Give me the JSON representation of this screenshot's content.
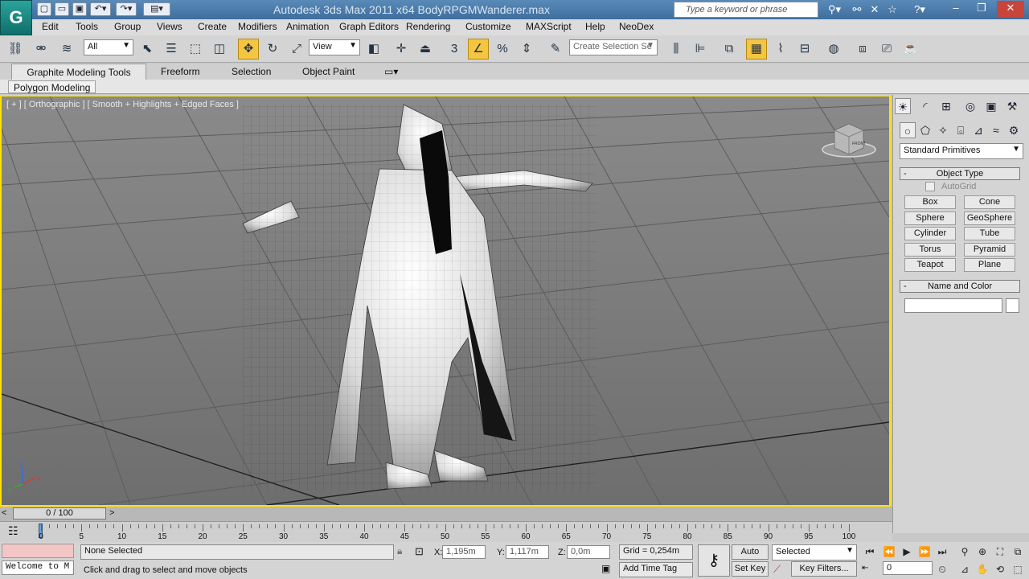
{
  "title_bar": {
    "app_logo": "G",
    "window_title": "Autodesk 3ds Max  2011 x64      BodyRPGMWanderer.max",
    "search_placeholder": "Type a keyword or phrase"
  },
  "menu": [
    "Edit",
    "Tools",
    "Group",
    "Views",
    "Create",
    "Modifiers",
    "Animation",
    "Graph Editors",
    "Rendering",
    "Customize",
    "MAXScript",
    "Help",
    "NeoDex"
  ],
  "toolbar": {
    "filter_value": "All",
    "ref_coord_value": "View",
    "selection_set_placeholder": "Create Selection Se",
    "snap_value": "3"
  },
  "ribbon": {
    "tabs": [
      "Graphite Modeling Tools",
      "Freeform",
      "Selection",
      "Object Paint"
    ],
    "panel_label": "Polygon Modeling"
  },
  "viewport": {
    "label": "[ + ] [ Orthographic ] [ Smooth + Highlights + Edged Faces ]",
    "viewcube_label": "FRONT",
    "axes": {
      "x": "x",
      "y": "y",
      "z": "z"
    }
  },
  "command_panel": {
    "category_value": "Standard Primitives",
    "object_type_title": "Object Type",
    "autogrid_label": "AutoGrid",
    "primitives": [
      "Box",
      "Cone",
      "Sphere",
      "GeoSphere",
      "Cylinder",
      "Tube",
      "Torus",
      "Pyramid",
      "Teapot",
      "Plane"
    ],
    "name_color_title": "Name and Color",
    "name_value": ""
  },
  "timeline": {
    "frame_display": "0 / 100",
    "ticks": [
      "0",
      "5",
      "10",
      "15",
      "20",
      "25",
      "30",
      "35",
      "40",
      "45",
      "50",
      "55",
      "60",
      "65",
      "70",
      "75",
      "80",
      "85",
      "90",
      "95",
      "100"
    ]
  },
  "status": {
    "maxscript_listener": "Welcome to M",
    "selection_status": "None Selected",
    "prompt": "Click and drag to select and move objects",
    "x_label": "X:",
    "x_value": "1,195m",
    "y_label": "Y:",
    "y_value": "1,117m",
    "z_label": "Z:",
    "z_value": "0,0m",
    "grid": "Grid = 0,254m",
    "add_time_tag": "Add Time Tag",
    "auto_key": "Auto Key",
    "set_key": "Set Key",
    "key_mode_value": "Selected",
    "key_filters": "Key Filters...",
    "current_frame": "0"
  }
}
